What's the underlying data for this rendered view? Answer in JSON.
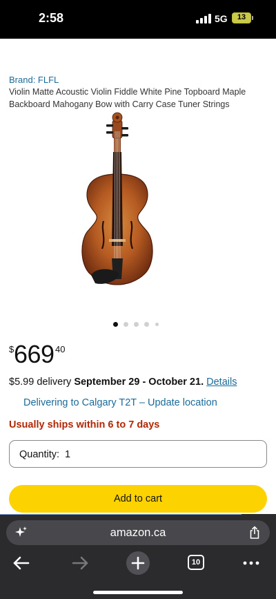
{
  "status_bar": {
    "time": "2:58",
    "network": "5G",
    "battery": "13"
  },
  "product": {
    "brand": "Brand: FLFL",
    "title": "Violin Matte Acoustic Violin Fiddle White Pine Topboard Maple Backboard Mahogany Bow with Carry Case Tuner Strings",
    "image_icon": "violin-image",
    "carousel": {
      "count": 5,
      "active_index": 0
    }
  },
  "price": {
    "currency": "$",
    "whole": "669",
    "fraction": "40"
  },
  "delivery": {
    "prefix": "$5.99 delivery",
    "dates": "September 29 - October 21",
    "separator": ".",
    "details_link": "Details",
    "location_text": "Delivering to Calgary T2T – Update location",
    "ships_text": "Usually ships within 6 to 7 days"
  },
  "quantity": {
    "label": "Quantity:",
    "value": "1"
  },
  "add_to_cart": {
    "label": "Add to cart",
    "color": "#fcd200"
  },
  "browser": {
    "url": "amazon.ca",
    "tab_count": "10",
    "icons": [
      "sparkle-icon",
      "share-icon",
      "back-arrow-icon",
      "forward-arrow-icon",
      "new-tab-plus-icon",
      "tabs-icon",
      "more-icon"
    ]
  },
  "colors": {
    "link": "#1a6b99",
    "ships": "#b12704",
    "cart": "#fcd200"
  }
}
